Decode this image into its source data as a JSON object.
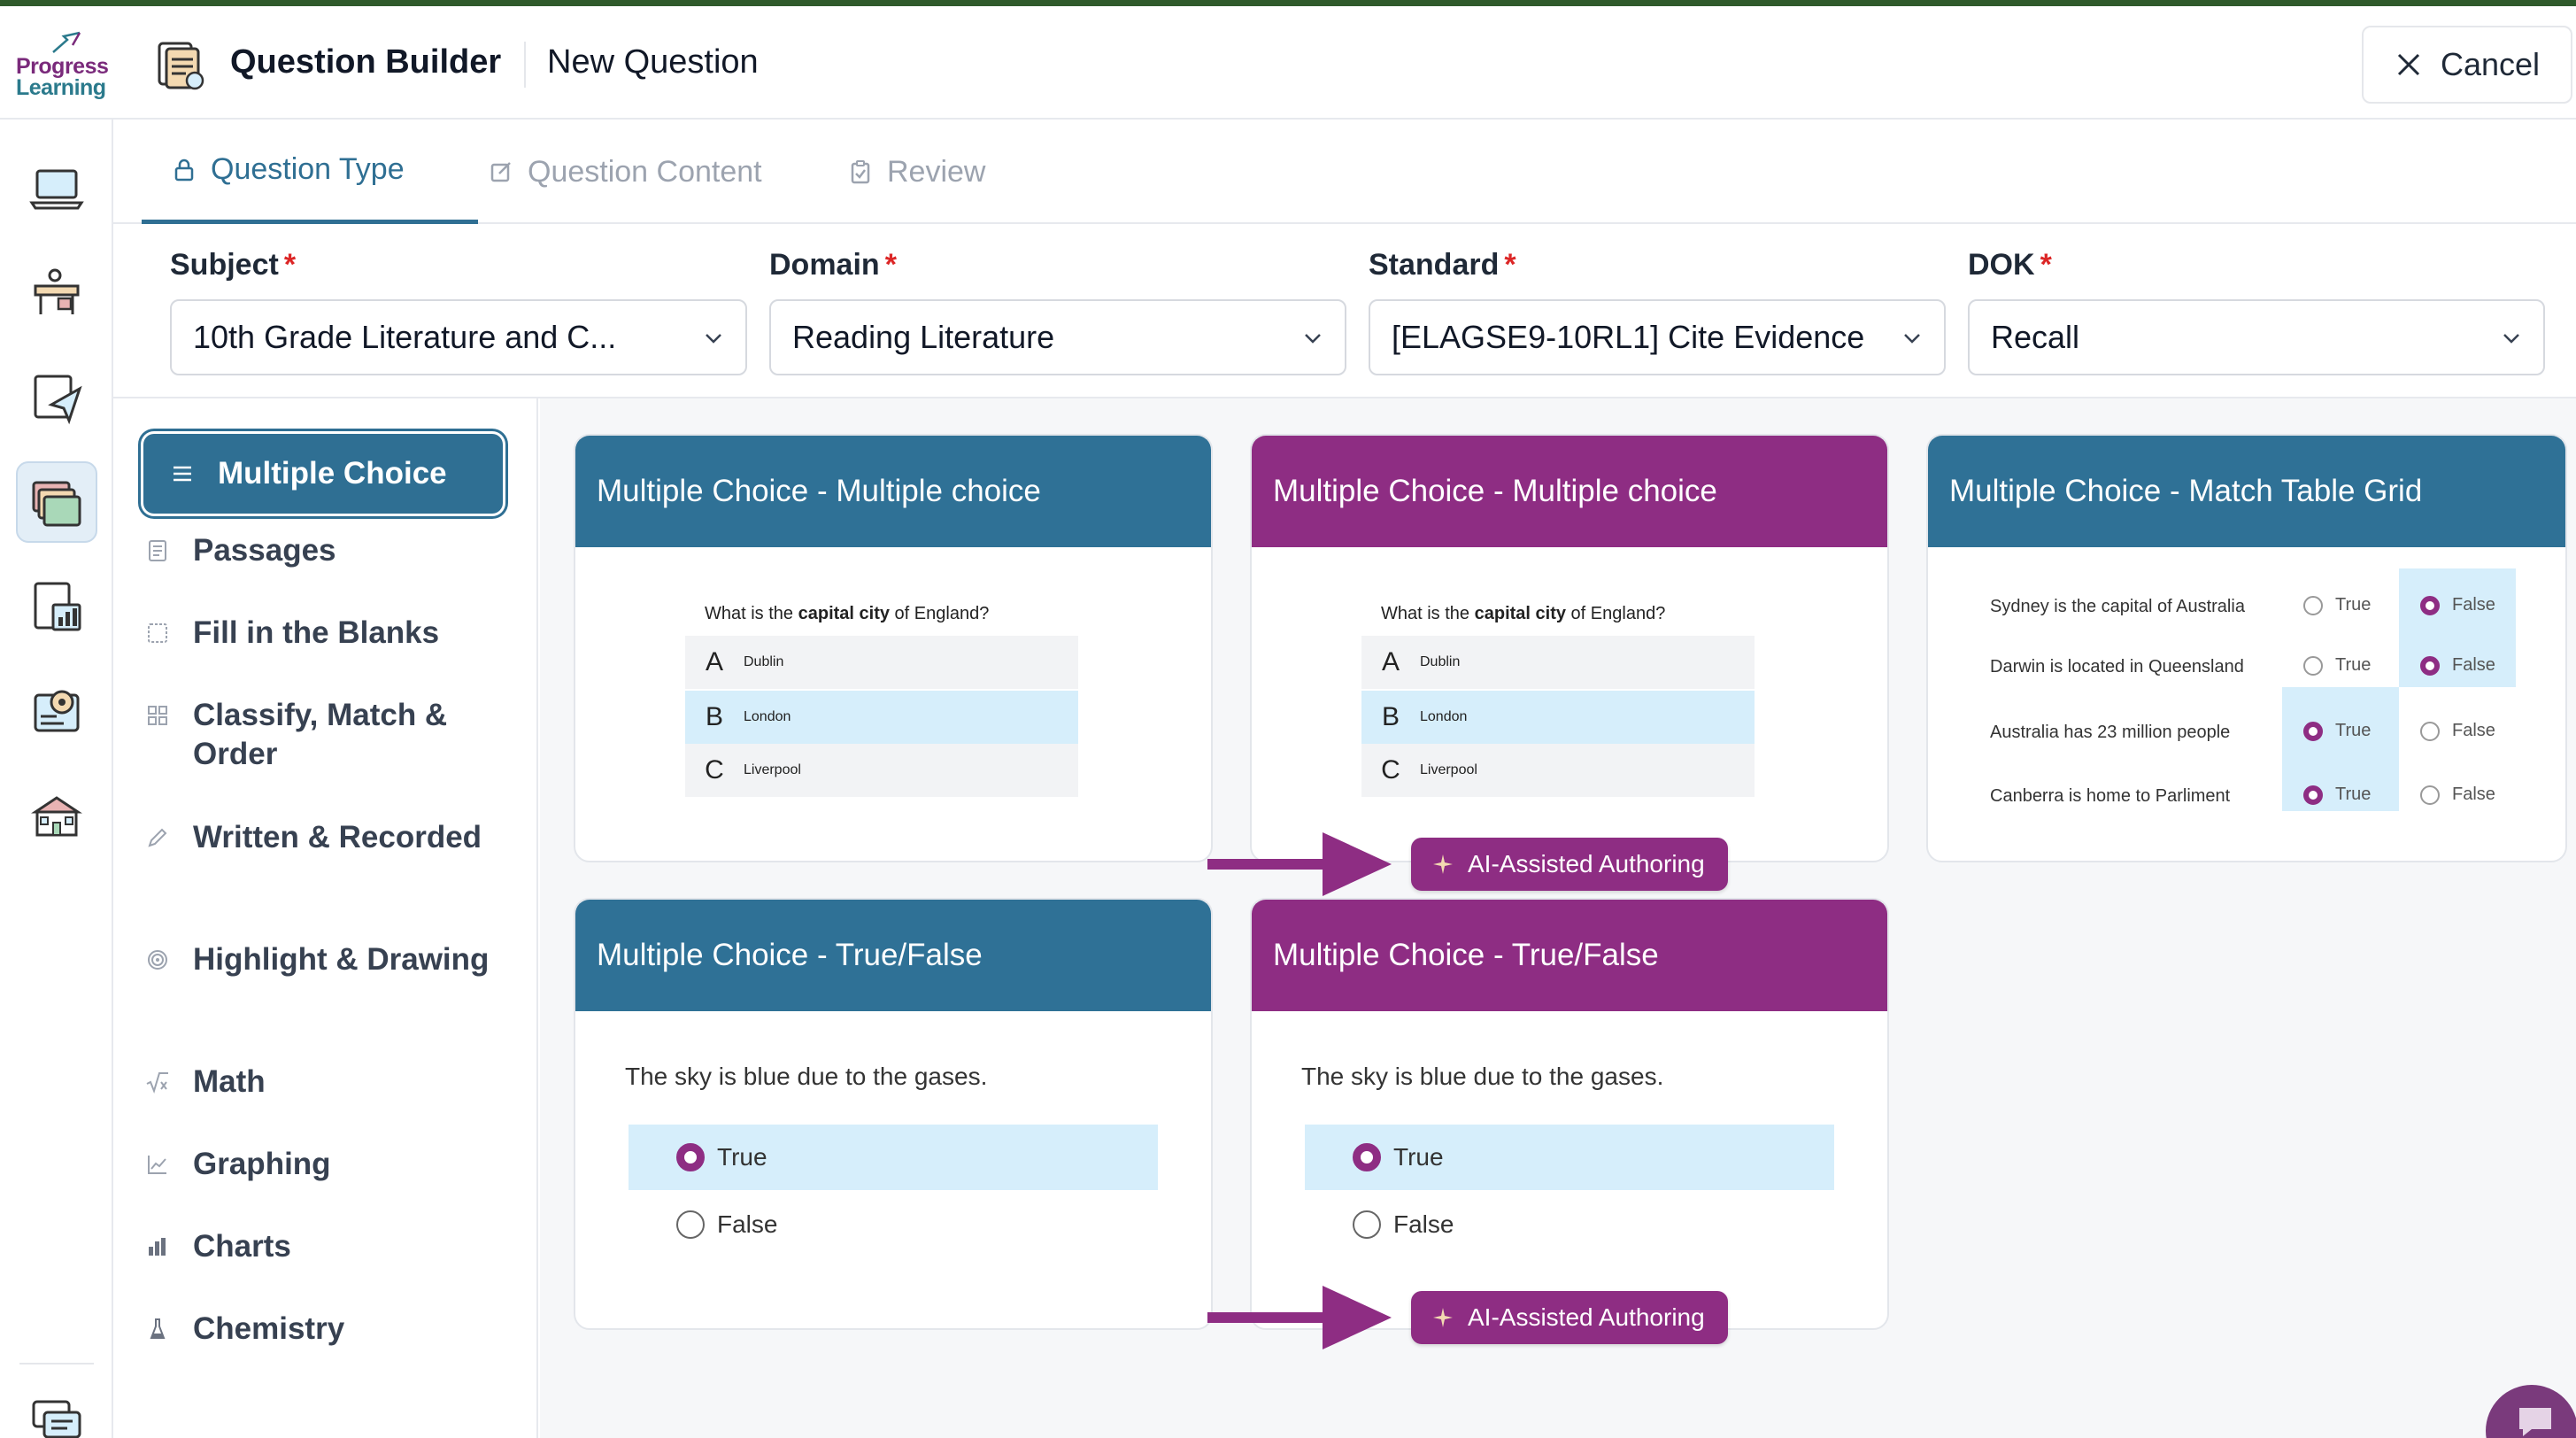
{
  "app": {
    "logo_line1": "Progress",
    "logo_line2": "Learning",
    "title": "Question Builder",
    "subtitle": "New Question",
    "cancel_label": "Cancel"
  },
  "rail": {
    "icons": [
      "laptop-icon",
      "classroom-desk-icon",
      "assignment-send-icon",
      "question-bank-icon",
      "report-chart-icon",
      "settings-document-icon",
      "school-building-icon",
      "chat-feedback-icon"
    ],
    "active_index": 3
  },
  "tabs": [
    {
      "label": "Question Type",
      "icon": "lock-icon",
      "active": true
    },
    {
      "label": "Question Content",
      "icon": "edit-icon",
      "active": false
    },
    {
      "label": "Review",
      "icon": "clipboard-icon",
      "active": false
    }
  ],
  "fields": {
    "subject": {
      "label": "Subject",
      "value": "10th Grade Literature and C..."
    },
    "domain": {
      "label": "Domain",
      "value": "Reading Literature"
    },
    "standard": {
      "label": "Standard",
      "value": "[ELAGSE9-10RL1] Cite Evidence"
    },
    "dok": {
      "label": "DOK",
      "value": "Recall"
    },
    "required_mark": "*"
  },
  "categories": [
    {
      "label": "Multiple Choice",
      "icon": "list-icon",
      "active": true
    },
    {
      "label": "Passages",
      "icon": "document-icon"
    },
    {
      "label": "Fill in the Blanks",
      "icon": "blank-box-icon"
    },
    {
      "label": "Classify, Match & Order",
      "icon": "grid-icon"
    },
    {
      "label": "Written & Recorded",
      "icon": "pencil-icon"
    },
    {
      "label": "Highlight & Drawing",
      "icon": "target-icon"
    },
    {
      "label": "Math",
      "icon": "square-root-icon"
    },
    {
      "label": "Graphing",
      "icon": "line-graph-icon"
    },
    {
      "label": "Charts",
      "icon": "bar-chart-icon"
    },
    {
      "label": "Chemistry",
      "icon": "flask-icon"
    }
  ],
  "cards": {
    "mc1": {
      "title": "Multiple Choice - Multiple choice",
      "q_prefix": "What is the ",
      "q_bold": "capital city",
      "q_suffix": " of England?",
      "options": [
        {
          "letter": "A",
          "text": "Dublin"
        },
        {
          "letter": "B",
          "text": "London"
        },
        {
          "letter": "C",
          "text": "Liverpool"
        }
      ],
      "selected": 1
    },
    "mc2": {
      "title": "Multiple Choice - Multiple choice",
      "q_prefix": "What is the ",
      "q_bold": "capital city",
      "q_suffix": " of England?",
      "options": [
        {
          "letter": "A",
          "text": "Dublin"
        },
        {
          "letter": "B",
          "text": "London"
        },
        {
          "letter": "C",
          "text": "Liverpool"
        }
      ],
      "selected": 1,
      "badge": "AI-Assisted Authoring"
    },
    "grid": {
      "title": "Multiple Choice - Match Table Grid",
      "true_label": "True",
      "false_label": "False",
      "rows": [
        {
          "text": "Sydney is the capital of Australia",
          "answer": "False"
        },
        {
          "text": "Darwin is located in Queensland",
          "answer": "False"
        },
        {
          "text": "Australia has 23 million people",
          "answer": "True"
        },
        {
          "text": "Canberra is home to Parliment",
          "answer": "True"
        }
      ]
    },
    "tf1": {
      "title": "Multiple Choice - True/False",
      "question": "The sky is blue due to the gases.",
      "options": [
        "True",
        "False"
      ],
      "selected": 0
    },
    "tf2": {
      "title": "Multiple Choice - True/False",
      "question": "The sky is blue due to the gases.",
      "options": [
        "True",
        "False"
      ],
      "selected": 0,
      "badge": "AI-Assisted Authoring"
    }
  },
  "colors": {
    "primary_blue": "#2f7196",
    "ai_purple": "#8e2d83",
    "selected_highlight": "#d6eefb",
    "required_red": "#dc2626"
  }
}
